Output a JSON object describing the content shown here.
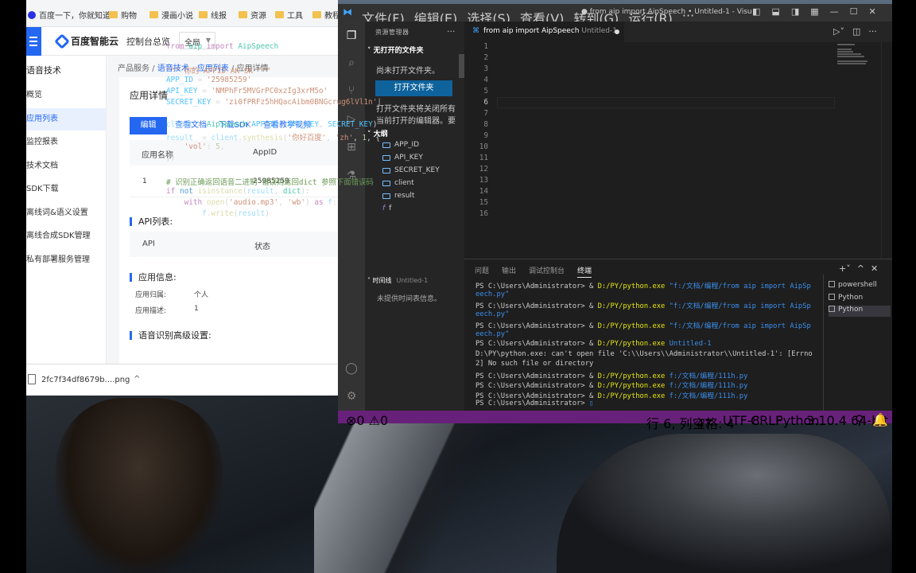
{
  "bookmarks": [
    {
      "label": "百度一下，你就知道",
      "icon": "baidu-icon"
    },
    {
      "label": "购物",
      "icon": "folder-icon"
    },
    {
      "label": "漫画小说",
      "icon": "folder-icon"
    },
    {
      "label": "线报",
      "icon": "folder-icon"
    },
    {
      "label": "资源",
      "icon": "folder-icon"
    },
    {
      "label": "工具",
      "icon": "folder-icon"
    },
    {
      "label": "教程",
      "icon": "folder-icon"
    }
  ],
  "baidu": {
    "logo": "百度智能云",
    "console_home": "控制台总览",
    "region": "全局",
    "sidebar_head": "语音技术",
    "sidebar": [
      "概览",
      "应用列表",
      "监控报表",
      "技术文档",
      "SDK下载",
      "离线词&语义设置",
      "离线合成SDK管理",
      "私有部署服务管理"
    ],
    "breadcrumb": {
      "root": "产品服务",
      "sep1": "/",
      "link": "语音技术 - 应用列表",
      "sep2": "/",
      "current": "应用详情"
    },
    "card_title": "应用详情",
    "tabs": [
      "编辑",
      "查看文档",
      "下载SDK",
      "查看教学视频"
    ],
    "table": {
      "headers": [
        "应用名称",
        "AppID"
      ],
      "row": [
        "1",
        "25985259"
      ]
    },
    "api_list_title": "API列表:",
    "api_headers": [
      "API",
      "状态"
    ],
    "app_info_title": "应用信息:",
    "app_info": [
      {
        "k": "应用归属:",
        "v": "个人"
      },
      {
        "k": "应用描述:",
        "v": "1"
      }
    ],
    "asr_title": "语音识别高级设置:"
  },
  "download": {
    "filename": "2fc7f34df8679b....png"
  },
  "vscode": {
    "menus": [
      "文件(F)",
      "编辑(E)",
      "选择(S)",
      "查看(V)",
      "转到(G)",
      "运行(R)",
      "···"
    ],
    "title": "● from aip import AipSpeech • Untitled-1 - Visual St...",
    "explorer_head": "资源管理器",
    "no_folder_head": "无打开的文件夹",
    "no_folder_msg": "尚未打开文件夹。",
    "open_folder_btn": "打开文件夹",
    "close_msg": "打开文件夹将关闭所有当前打开的编辑器。要",
    "outline_head": "大纲",
    "outline": [
      {
        "label": "APP_ID",
        "kind": "var"
      },
      {
        "label": "API_KEY",
        "kind": "var"
      },
      {
        "label": "SECRET_KEY",
        "kind": "var"
      },
      {
        "label": "client",
        "kind": "var"
      },
      {
        "label": "result",
        "kind": "var"
      },
      {
        "label": "f",
        "kind": "fn"
      }
    ],
    "timeline_head": "时间线",
    "timeline_sub": "Untitled-1",
    "timeline_msg": "未提供时间表信息。",
    "tab": {
      "label": "from aip import AipSpeech",
      "sub": "Untitled-1"
    },
    "line_numbers": [
      "1",
      "2",
      "3",
      "4",
      "5",
      "6",
      "7",
      "8",
      "9",
      "10",
      "11",
      "12",
      "13",
      "14",
      "15",
      "16"
    ],
    "current_line": "6",
    "panel_tabs": [
      "问题",
      "输出",
      "调试控制台",
      "终端"
    ],
    "terminal": [
      {
        "prompt": "PS C:\\Users\\Administrator> & ",
        "cmd": "D:/PY/python.exe",
        "arg": " \"f:/文档/编程/from aip import AipSp"
      },
      {
        "prompt": "",
        "cmd": "",
        "arg": "eech.py\""
      },
      {
        "prompt": "PS C:\\Users\\Administrator> & ",
        "cmd": "D:/PY/python.exe",
        "arg": " \"f:/文档/编程/from aip import AipSp"
      },
      {
        "prompt": "",
        "cmd": "",
        "arg": "eech.py\""
      },
      {
        "prompt": "PS C:\\Users\\Administrator> & ",
        "cmd": "D:/PY/python.exe",
        "arg": " \"f:/文档/编程/from aip import AipSp"
      },
      {
        "prompt": "",
        "cmd": "",
        "arg": "eech.py\""
      },
      {
        "prompt": "PS C:\\Users\\Administrator> & ",
        "cmd": "D:/PY/python.exe",
        "arg": " Untitled-1"
      },
      {
        "prompt": "D:\\PY\\python.exe: can't open file 'C:\\\\Users\\\\Administrator\\\\Untitled-1': [Errno",
        "cmd": "",
        "arg": ""
      },
      {
        "prompt": "2] No such file or directory",
        "cmd": "",
        "arg": ""
      },
      {
        "prompt": "PS C:\\Users\\Administrator> & ",
        "cmd": "D:/PY/python.exe",
        "arg": " f:/文档/编程/111h.py"
      },
      {
        "prompt": "PS C:\\Users\\Administrator> & ",
        "cmd": "D:/PY/python.exe",
        "arg": " f:/文档/编程/111h.py"
      },
      {
        "prompt": "PS C:\\Users\\Administrator> & ",
        "cmd": "D:/PY/python.exe",
        "arg": " f:/文档/编程/111h.py"
      },
      {
        "prompt": "PS C:\\Users\\Administrator> ",
        "cmd": "",
        "arg": "▯"
      }
    ],
    "terminals": [
      "powershell",
      "Python",
      "Python"
    ],
    "status": {
      "errors": "⊗0 ⚠0",
      "position": "行 6, 列 47",
      "spaces": "空格: 4",
      "encoding": "UTF-8",
      "eol": "CRLF",
      "language": "Python",
      "interpreter": "3.10.4 64-bit"
    }
  }
}
